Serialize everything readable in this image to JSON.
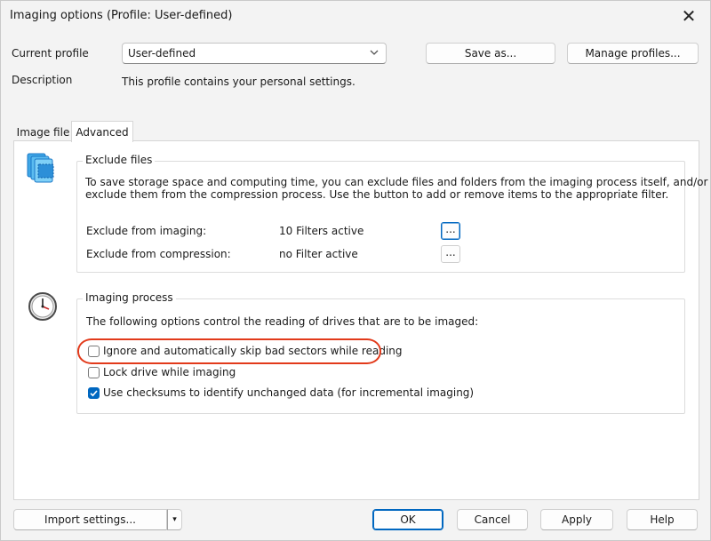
{
  "window": {
    "title": "Imaging options (Profile: User-defined)",
    "close_glyph": "✕"
  },
  "profile": {
    "current_label": "Current profile",
    "selected": "User-defined",
    "description_label": "Description",
    "description_text": "This profile contains your personal settings.",
    "save_as_label": "Save as...",
    "manage_label": "Manage profiles..."
  },
  "tabs": [
    {
      "label": "Image file",
      "active": false
    },
    {
      "label": "Advanced",
      "active": true
    }
  ],
  "exclude": {
    "title": "Exclude files",
    "text_line1": "To save storage space and computing time, you can exclude files and folders from the imaging process itself, and/or",
    "text_line2": "exclude them from the compression process. Use the button to add or remove items to the appropriate filter.",
    "imaging_label": "Exclude from imaging:",
    "imaging_value": "10 Filters active",
    "compression_label": "Exclude from compression:",
    "compression_value": "no Filter active",
    "button_label": "..."
  },
  "imaging_process": {
    "title": "Imaging process",
    "intro": "The following options control the reading of drives that are to be imaged:",
    "options": [
      {
        "label": "Ignore and automatically skip bad sectors while reading",
        "checked": false
      },
      {
        "label": "Lock drive while imaging",
        "checked": false
      },
      {
        "label": "Use checksums to identify unchanged data (for incremental imaging)",
        "checked": true
      }
    ]
  },
  "footer": {
    "import_label": "Import settings...",
    "import_arrow": "▾",
    "ok_label": "OK",
    "cancel_label": "Cancel",
    "apply_label": "Apply",
    "help_label": "Help"
  },
  "colors": {
    "accent": "#0067c0",
    "highlight": "#e23a1b",
    "window_bg": "#f3f3f3",
    "panel_bg": "#ffffff"
  },
  "icons": {
    "exclude": "files-stack-icon",
    "process": "clock-icon"
  }
}
